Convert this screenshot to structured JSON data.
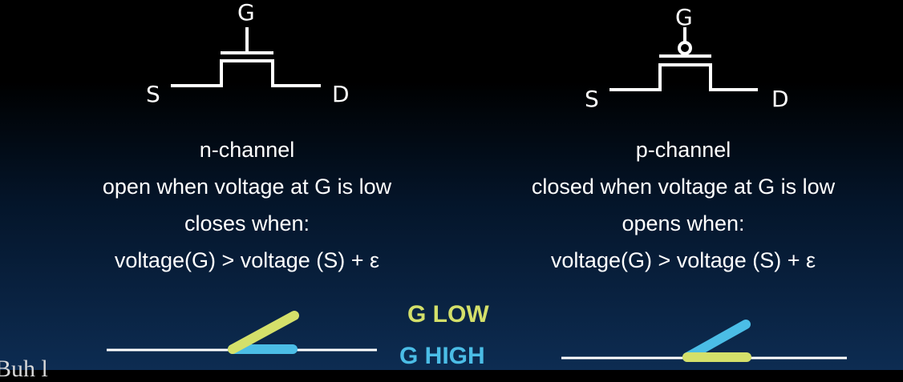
{
  "nmos": {
    "gate_label": "G",
    "source_label": "S",
    "drain_label": "D",
    "lines": [
      "n-channel",
      "open when voltage at G is low",
      "closes when:",
      "voltage(G) > voltage (S) + ε"
    ]
  },
  "pmos": {
    "gate_label": "G",
    "source_label": "S",
    "drain_label": "D",
    "lines": [
      "p-channel",
      "closed when voltage at G is low",
      "opens when:",
      "voltage(G) > voltage (S) + ε"
    ]
  },
  "legend": {
    "low_label": "G LOW",
    "high_label": "G HIGH",
    "low_color": "#d4e06a",
    "high_color": "#4bbde6"
  },
  "partial_text": "Buh l"
}
